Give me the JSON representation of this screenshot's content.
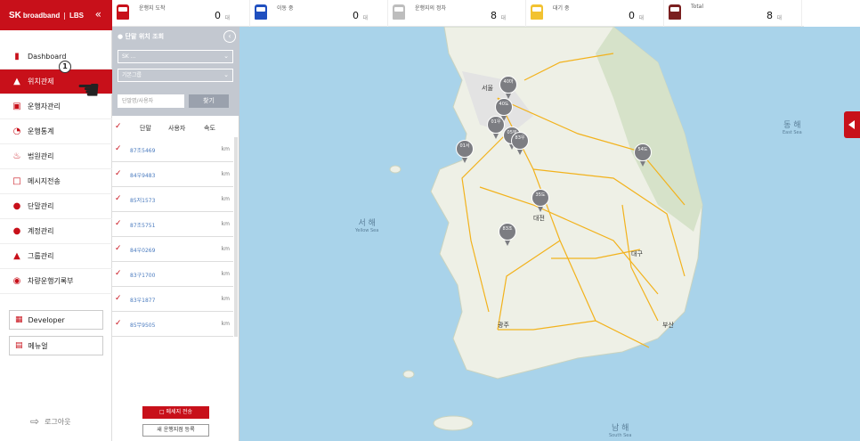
{
  "brand": {
    "logo_sk": "SK",
    "logo_text": "broadband",
    "logo_product": "LBS"
  },
  "colors": {
    "brand_red": "#c8101a",
    "driving": "#c8101a",
    "moving": "#1f4fbf",
    "stopped": "#bdbdbd",
    "waiting": "#f2c230",
    "total": "#7a1f1f"
  },
  "nav": {
    "items": [
      {
        "label": "Dashboard",
        "icon": "bar-chart-icon"
      },
      {
        "label": "위치관제",
        "icon": "car-location-icon"
      },
      {
        "label": "운행자관리",
        "icon": "car-icon"
      },
      {
        "label": "운행통계",
        "icon": "pie-chart-icon"
      },
      {
        "label": "법원관리",
        "icon": "bell-icon"
      },
      {
        "label": "메시지전송",
        "icon": "message-icon"
      },
      {
        "label": "단말관리",
        "icon": "pin-icon"
      },
      {
        "label": "계정관리",
        "icon": "users-icon"
      },
      {
        "label": "그룹관리",
        "icon": "org-chart-icon"
      },
      {
        "label": "차량운행기록부",
        "icon": "log-pin-icon"
      }
    ],
    "active_index": 1,
    "badge": "1",
    "developer_label": "Developer",
    "manual_label": "메뉴얼",
    "logout_label": "로그아웃"
  },
  "status": [
    {
      "label": "운행지 도착",
      "value": "0",
      "unit": "대",
      "color": "#c8101a"
    },
    {
      "label": "이동 중",
      "value": "0",
      "unit": "대",
      "color": "#1f4fbf"
    },
    {
      "label": "운행지의 정차",
      "value": "8",
      "unit": "대",
      "color": "#bdbdbd"
    },
    {
      "label": "대기 중",
      "value": "0",
      "unit": "대",
      "color": "#f2c230"
    },
    {
      "label": "Total",
      "value": "8",
      "unit": "대",
      "color": "#7a1f1f"
    }
  ],
  "panel": {
    "title": "단말 위치 조회",
    "select1": "SK ...",
    "select2": "기본그룹",
    "search_placeholder": "단말명/사용자",
    "search_button": "찾기",
    "col_terminal": "단말",
    "col_user": "사용자",
    "col_speed": "속도",
    "rows": [
      {
        "terminal": "87조5469",
        "unit": "km"
      },
      {
        "terminal": "84우9483",
        "unit": "km"
      },
      {
        "terminal": "85저1573",
        "unit": "km"
      },
      {
        "terminal": "87조5751",
        "unit": "km"
      },
      {
        "terminal": "84우0269",
        "unit": "km"
      },
      {
        "terminal": "83구1700",
        "unit": "km"
      },
      {
        "terminal": "83우1877",
        "unit": "km"
      },
      {
        "terminal": "85무9505",
        "unit": "km"
      }
    ],
    "send_message": "메세지 전송",
    "register_new": "새 운행지점 등록"
  },
  "map": {
    "labels": [
      {
        "name": "서 해",
        "sub": "Yellow Sea"
      },
      {
        "name": "동 해",
        "sub": "East Sea"
      },
      {
        "name": "남 해",
        "sub": "South Sea"
      },
      {
        "name": "서울",
        "sub": ""
      },
      {
        "name": "대전",
        "sub": ""
      },
      {
        "name": "대구",
        "sub": ""
      },
      {
        "name": "광주",
        "sub": ""
      },
      {
        "name": "부산",
        "sub": ""
      }
    ],
    "pins": [
      "40마",
      "40도",
      "01우",
      "05무",
      "83우",
      "01서",
      "54도",
      "35도",
      "83조"
    ]
  }
}
